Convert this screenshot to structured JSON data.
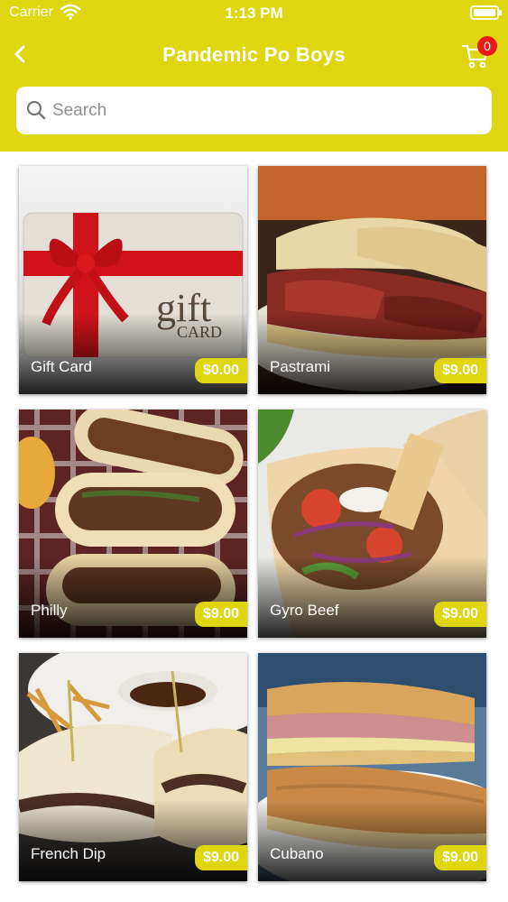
{
  "status": {
    "carrier": "Carrier",
    "time": "1:13 PM"
  },
  "header": {
    "title": "Pandemic Po Boys",
    "cart_count": "0"
  },
  "search": {
    "placeholder": "Search",
    "value": ""
  },
  "colors": {
    "accent": "#dfd60f",
    "badge": "#e81b1b"
  },
  "icons": {
    "back": "chevron-left-icon",
    "cart": "cart-icon",
    "search": "search-icon"
  },
  "items": [
    {
      "name": "Gift Card",
      "price": "$0.00"
    },
    {
      "name": "Pastrami",
      "price": "$9.00"
    },
    {
      "name": "Philly",
      "price": "$9.00"
    },
    {
      "name": "Gyro Beef",
      "price": "$9.00"
    },
    {
      "name": "French Dip",
      "price": "$9.00"
    },
    {
      "name": "Cubano",
      "price": "$9.00"
    }
  ]
}
